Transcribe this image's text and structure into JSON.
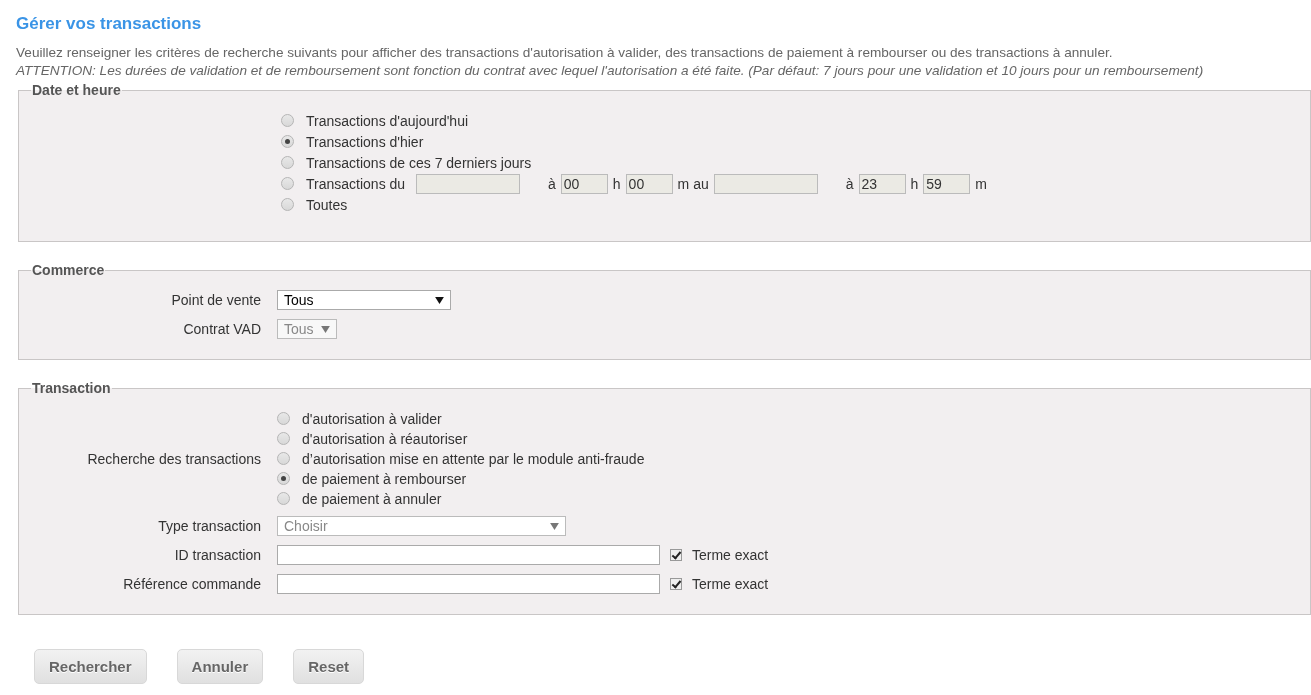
{
  "title": "Gérer vos transactions",
  "intro": "Veuillez renseigner les critères de recherche suivants pour afficher des transactions d'autorisation à valider, des transactions de paiement à rembourser ou des transactions à annuler.",
  "warning": "ATTENTION: Les durées de validation et de remboursement sont fonction du contrat avec lequel l'autorisation a été faite. (Par défaut: 7 jours pour une validation et 10 jours pour un remboursement)",
  "date_section": {
    "legend": "Date et heure",
    "options": [
      {
        "kind": "plain",
        "label": "Transactions d'aujourd'hui",
        "selected": false
      },
      {
        "kind": "plain",
        "label": "Transactions d'hier",
        "selected": true
      },
      {
        "kind": "plain",
        "label": "Transactions de ces 7 derniers jours",
        "selected": false
      },
      {
        "kind": "range",
        "label": "Transactions du",
        "selected": false,
        "parts": [
          {
            "kind": "date"
          },
          {
            "kind": "text",
            "text": "à"
          },
          {
            "kind": "time",
            "value": "00"
          },
          {
            "kind": "text",
            "text": "h"
          },
          {
            "kind": "time",
            "value": "00"
          },
          {
            "kind": "text",
            "text": "m au"
          },
          {
            "kind": "date"
          },
          {
            "kind": "text",
            "text": "à"
          },
          {
            "kind": "time",
            "value": "23"
          },
          {
            "kind": "text",
            "text": "h"
          },
          {
            "kind": "time",
            "value": "59"
          },
          {
            "kind": "text",
            "text": "m"
          }
        ]
      },
      {
        "kind": "plain",
        "label": "Toutes",
        "selected": false
      }
    ]
  },
  "commerce_section": {
    "legend": "Commerce",
    "fields": [
      {
        "kind": "select",
        "label": "Point de vente",
        "value": "Tous",
        "disabled": false
      },
      {
        "kind": "select",
        "label": "Contrat VAD",
        "value": "Tous",
        "disabled": true
      }
    ]
  },
  "transaction_section": {
    "legend": "Transaction",
    "fields": [
      {
        "kind": "radios",
        "label": "Recherche des transactions",
        "options": [
          {
            "label": "d'autorisation à valider",
            "selected": false
          },
          {
            "label": "d'autorisation à réautoriser",
            "selected": false
          },
          {
            "label": "d’autorisation mise en attente par le module anti-fraude",
            "selected": false
          },
          {
            "label": "de paiement à rembourser",
            "selected": true
          },
          {
            "label": "de paiement à annuler",
            "selected": false
          }
        ]
      },
      {
        "kind": "select",
        "label": "Type transaction",
        "placeholder": "Choisir"
      },
      {
        "kind": "text",
        "label": "ID transaction",
        "checkbox": {
          "label": "Terme exact",
          "checked": true
        }
      },
      {
        "kind": "text",
        "label": "Référence commande",
        "checkbox": {
          "label": "Terme exact",
          "checked": true
        }
      }
    ]
  },
  "buttons": [
    "Rechercher",
    "Annuler",
    "Reset"
  ]
}
